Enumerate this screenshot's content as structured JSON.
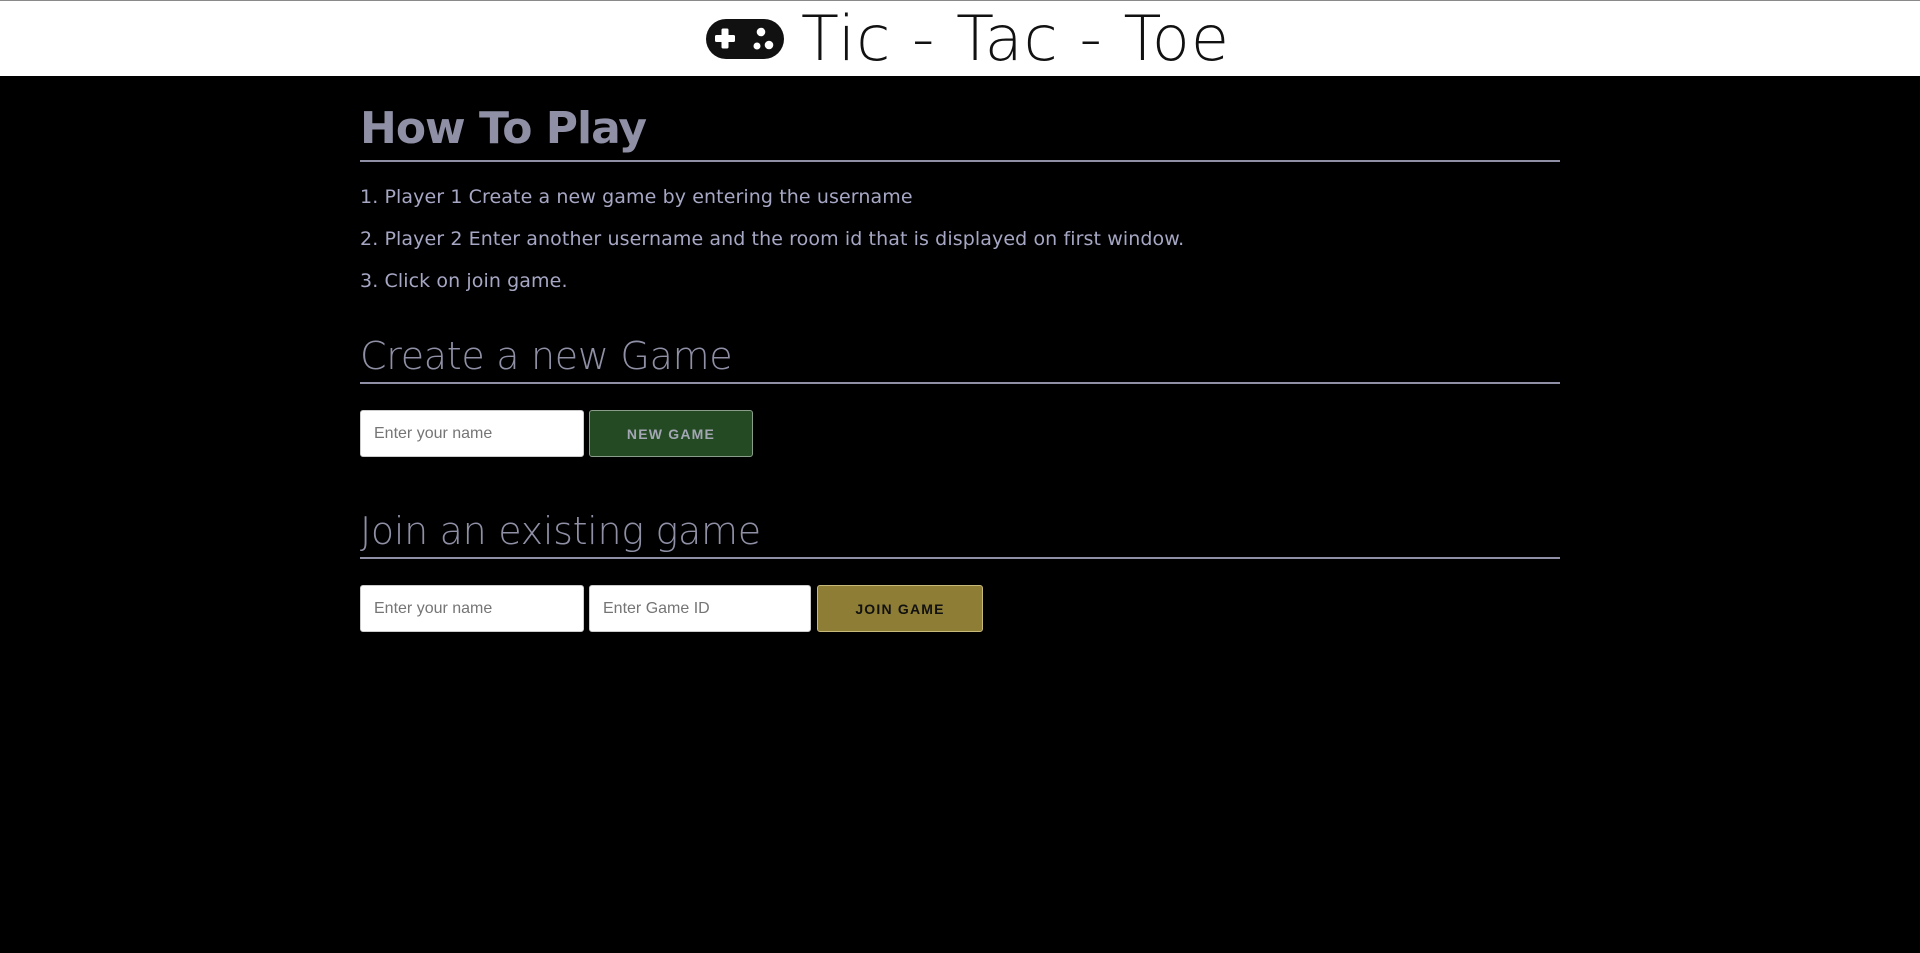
{
  "header": {
    "title": "Tic - Tac - Toe",
    "icon": "gamepad-icon"
  },
  "how_to_play": {
    "title": "How To Play",
    "steps": [
      "1. Player 1 Create a new game by entering the username",
      "2. Player 2 Enter another username and the room id that is displayed on first window.",
      "3. Click on join game."
    ]
  },
  "create_game": {
    "title": "Create a new Game",
    "name_placeholder": "Enter your name",
    "name_value": "",
    "button_label": "NEW GAME"
  },
  "join_game": {
    "title": "Join an existing game",
    "name_placeholder": "Enter your name",
    "name_value": "",
    "game_id_placeholder": "Enter Game ID",
    "game_id_value": "",
    "button_label": "JOIN GAME"
  },
  "colors": {
    "page_background": "#000000",
    "header_background": "#ffffff",
    "heading_color": "#8f90a6",
    "new_game_button": "#244a24",
    "join_game_button": "#8e7d34"
  }
}
